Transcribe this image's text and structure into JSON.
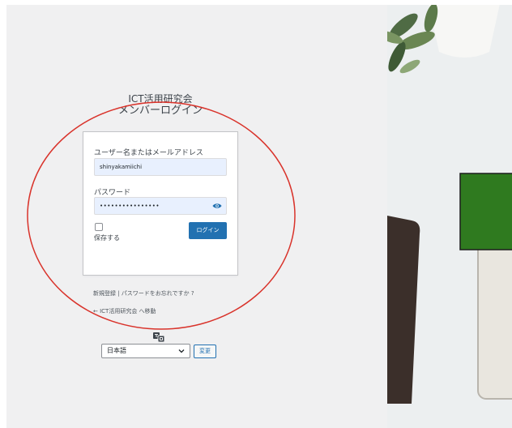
{
  "site": {
    "title_line1": "ICT活用研究会",
    "title_line2": "メンバーログイン"
  },
  "login_form": {
    "username_label": "ユーザー名またはメールアドレス",
    "username_value": "shinyakamiichi",
    "password_label": "パスワード",
    "password_value": "••••••••••••••••",
    "remember_label": "保存する",
    "remember_checked": false,
    "login_button_label": "ログイン"
  },
  "footer": {
    "register_lost_text": "新規登録 | パスワードをお忘れですか ?",
    "back_link_text": "← ICT活用研究会 へ移動"
  },
  "language": {
    "selected": "日本語",
    "change_button_label": "変更"
  },
  "icons": {
    "eye": "eye-icon",
    "translate": "translate-icon",
    "chevron": "chevron-down-icon"
  },
  "colors": {
    "accent": "#2271b1",
    "annotation": "#d9332b",
    "background": "#f0f0f1"
  }
}
